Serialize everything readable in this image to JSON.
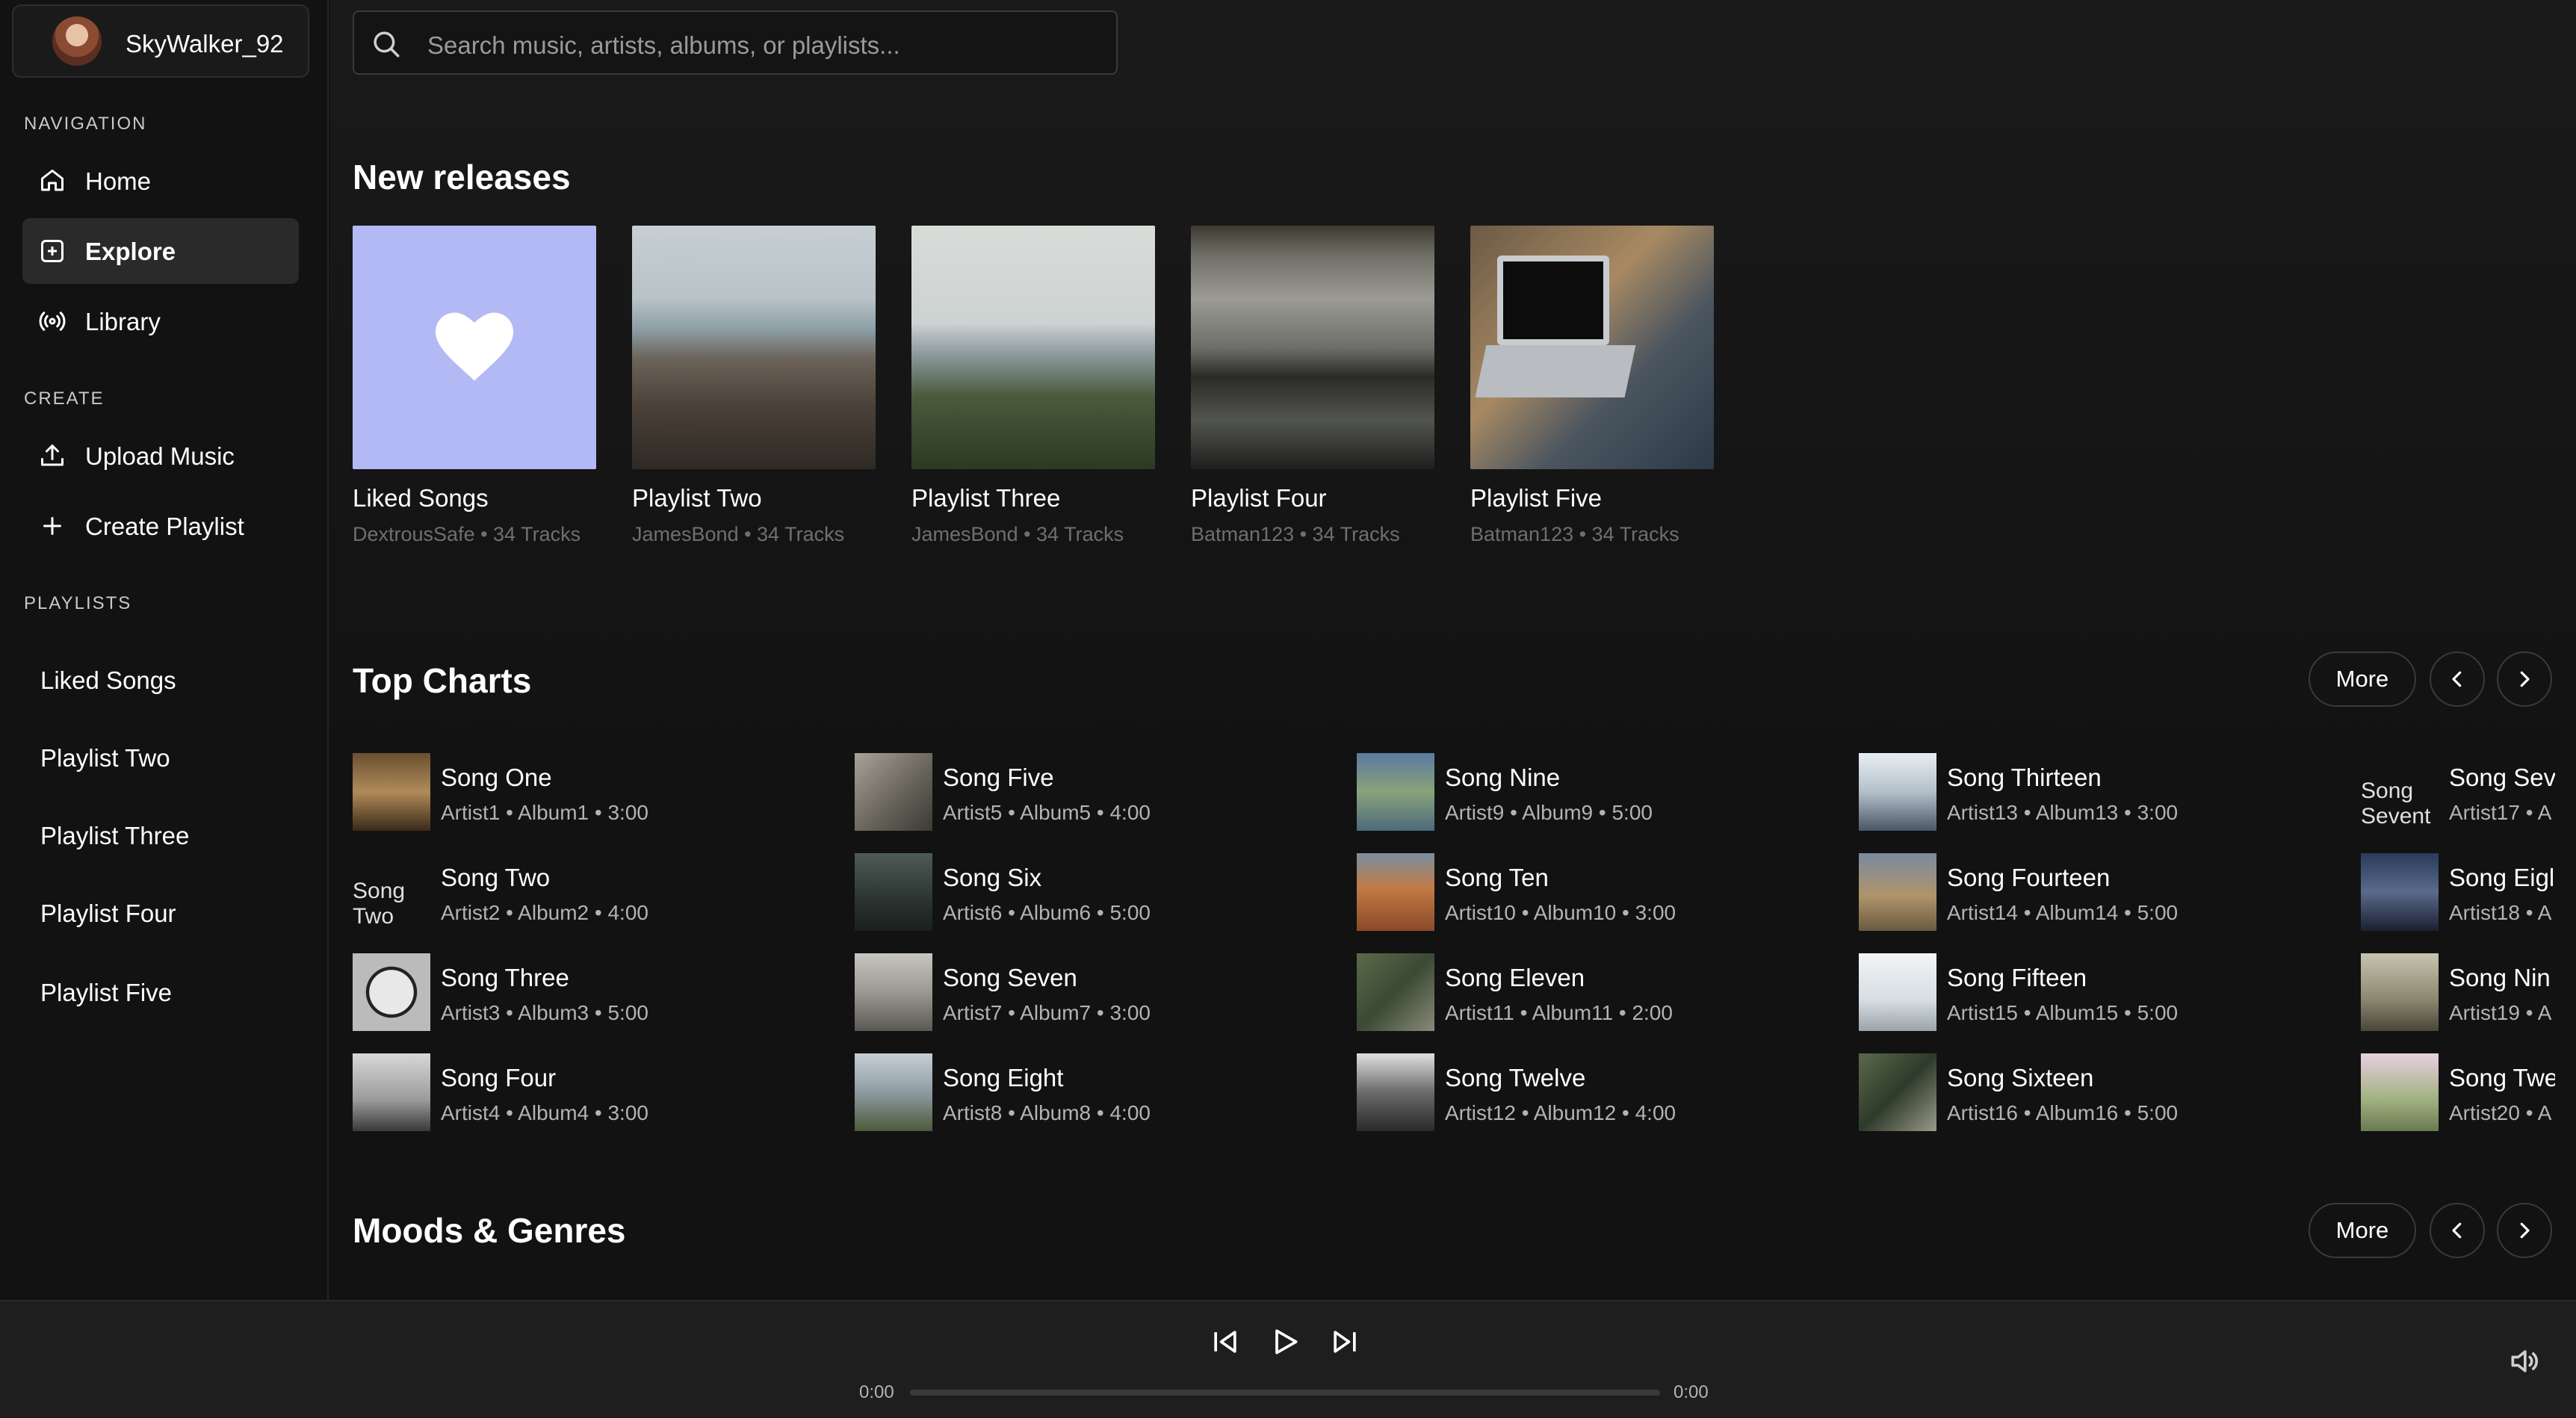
{
  "profile": {
    "username": "SkyWalker_92"
  },
  "sidebar": {
    "nav_label": "NAVIGATION",
    "nav": [
      {
        "label": "Home",
        "icon": "home-icon"
      },
      {
        "label": "Explore",
        "icon": "explore-icon",
        "active": true
      },
      {
        "label": "Library",
        "icon": "radio-icon"
      }
    ],
    "create_label": "CREATE",
    "create": [
      {
        "label": "Upload Music",
        "icon": "upload-icon"
      },
      {
        "label": "Create Playlist",
        "icon": "plus-icon"
      }
    ],
    "playlists_label": "PLAYLISTS",
    "playlists": [
      "Liked Songs",
      "Playlist Two",
      "Playlist Three",
      "Playlist Four",
      "Playlist Five"
    ]
  },
  "search": {
    "placeholder": "Search music, artists, albums, or playlists..."
  },
  "new_releases": {
    "title": "New releases",
    "cards": [
      {
        "title": "Liked Songs",
        "sub": "DextrousSafe • 34 Tracks"
      },
      {
        "title": "Playlist Two",
        "sub": "JamesBond • 34 Tracks"
      },
      {
        "title": "Playlist Three",
        "sub": "JamesBond • 34 Tracks"
      },
      {
        "title": "Playlist Four",
        "sub": "Batman123 • 34 Tracks"
      },
      {
        "title": "Playlist Five",
        "sub": "Batman123 • 34 Tracks"
      }
    ]
  },
  "top_charts": {
    "title": "Top Charts",
    "more_label": "More",
    "songs": [
      {
        "title": "Song One",
        "meta": "Artist1 • Album1 • 3:00"
      },
      {
        "title": "Song Two",
        "meta": "Artist2 • Album2 • 4:00",
        "broken_alt": "Song Two"
      },
      {
        "title": "Song Three",
        "meta": "Artist3 • Album3 • 5:00"
      },
      {
        "title": "Song Four",
        "meta": "Artist4 • Album4 • 3:00"
      },
      {
        "title": "Song Five",
        "meta": "Artist5 • Album5 • 4:00"
      },
      {
        "title": "Song Six",
        "meta": "Artist6 • Album6 • 5:00"
      },
      {
        "title": "Song Seven",
        "meta": "Artist7 • Album7 • 3:00"
      },
      {
        "title": "Song Eight",
        "meta": "Artist8 • Album8 • 4:00"
      },
      {
        "title": "Song Nine",
        "meta": "Artist9 • Album9 • 5:00"
      },
      {
        "title": "Song Ten",
        "meta": "Artist10 • Album10 • 3:00"
      },
      {
        "title": "Song Eleven",
        "meta": "Artist11 • Album11 • 2:00"
      },
      {
        "title": "Song Twelve",
        "meta": "Artist12 • Album12 • 4:00"
      },
      {
        "title": "Song Thirteen",
        "meta": "Artist13 • Album13 • 3:00"
      },
      {
        "title": "Song Fourteen",
        "meta": "Artist14 • Album14 • 5:00"
      },
      {
        "title": "Song Fifteen",
        "meta": "Artist15 • Album15 • 5:00"
      },
      {
        "title": "Song Sixteen",
        "meta": "Artist16 • Album16 • 5:00"
      },
      {
        "title": "Song Sev",
        "meta": "Artist17 • A",
        "broken_alt": "Song Sevent"
      },
      {
        "title": "Song Eigl",
        "meta": "Artist18 • A"
      },
      {
        "title": "Song Nin",
        "meta": "Artist19 • A"
      },
      {
        "title": "Song Twe",
        "meta": "Artist20 • A"
      }
    ]
  },
  "moods": {
    "title": "Moods & Genres",
    "more_label": "More"
  },
  "player": {
    "elapsed": "0:00",
    "duration": "0:00",
    "progress": 0
  },
  "colors": {
    "accent_liked": "#b3b9f5",
    "bg": "#121212"
  }
}
